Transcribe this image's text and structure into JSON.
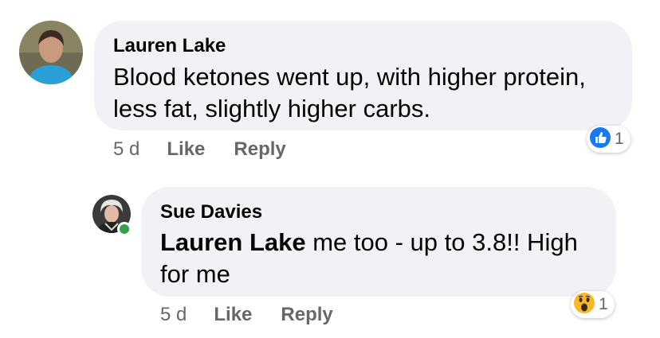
{
  "comments": [
    {
      "author": "Lauren Lake",
      "text": "Blood ketones went up, with higher protein, less fat, slightly higher carbs.",
      "time": "5 d",
      "like_label": "Like",
      "reply_label": "Reply",
      "reaction_icon": "like-icon",
      "reaction_count": "1"
    },
    {
      "author": "Sue Davies",
      "mention": "Lauren Lake",
      "text": " me too - up to 3.8!! High for me",
      "time": "5 d",
      "like_label": "Like",
      "reply_label": "Reply",
      "reaction_icon": "wow-icon",
      "reaction_count": "1",
      "online": true
    }
  ],
  "colors": {
    "bubble": "#f0f2f5",
    "meta": "#65676b",
    "like_blue": "#1877f2",
    "online_green": "#31a24c"
  }
}
